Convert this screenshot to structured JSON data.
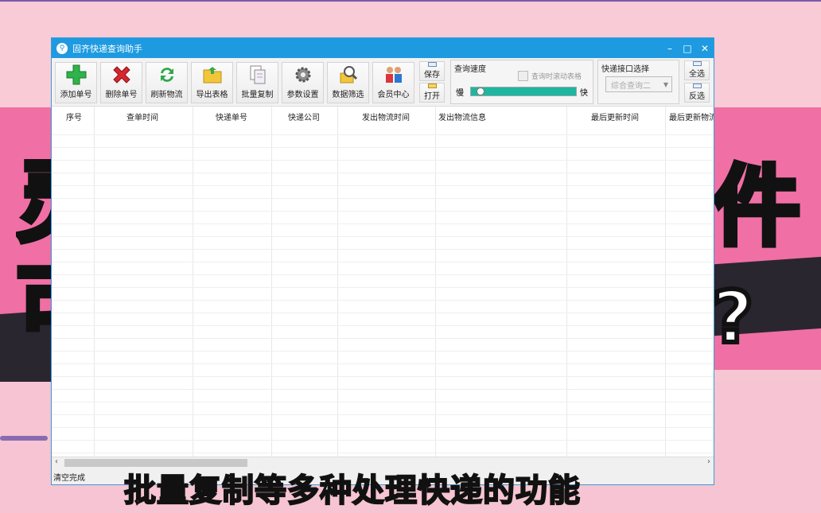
{
  "window": {
    "title": "固齐快递查询助手",
    "icon": "magnifier-truck-icon"
  },
  "toolbar": {
    "buttons": [
      {
        "label": "添加单号",
        "icon": "green-plus-icon"
      },
      {
        "label": "删除单号",
        "icon": "red-x-icon"
      },
      {
        "label": "刷新物流",
        "icon": "refresh-icon"
      },
      {
        "label": "导出表格",
        "icon": "folder-export-icon"
      },
      {
        "label": "批量复制",
        "icon": "copy-pages-icon"
      },
      {
        "label": "参数设置",
        "icon": "gear-icon"
      },
      {
        "label": "数据筛选",
        "icon": "search-filter-icon"
      },
      {
        "label": "会员中心",
        "icon": "members-icon"
      }
    ],
    "save_label": "保存",
    "open_label": "打开",
    "speed_group": {
      "title": "查询速度",
      "checkbox_label": "查询时滚动表格",
      "slow": "慢",
      "fast": "快",
      "speed_level": 0.05
    },
    "api_group": {
      "title": "快递接口选择",
      "selected": "综合查询二"
    },
    "select_all": "全选",
    "invert_select": "反选"
  },
  "grid": {
    "columns": [
      "序号",
      "查单时间",
      "快递单号",
      "快递公司",
      "发出物流时间",
      "发出物流信息",
      "最后更新时间",
      "最后更新物流"
    ]
  },
  "status": "清空完成",
  "caption": "批量复制等多种处理快递的功能",
  "colors": {
    "titlebar": "#1e9be0",
    "background_pink": "#f06fa5",
    "slider": "#1fb6a0"
  }
}
